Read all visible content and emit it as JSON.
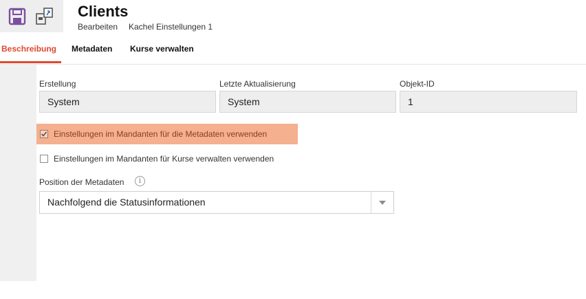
{
  "header": {
    "title": "Clients",
    "breadcrumb_1": "Bearbeiten",
    "breadcrumb_2": "Kachel Einstellungen 1",
    "tools": [
      {
        "icon": "save-icon",
        "color": "#7b4fa0"
      },
      {
        "icon": "sync-icon",
        "color": "#555555"
      }
    ]
  },
  "tabs": [
    {
      "label": "Beschreibung",
      "active": true
    },
    {
      "label": "Metadaten",
      "active": false
    },
    {
      "label": "Kurse verwalten",
      "active": false
    }
  ],
  "fields": {
    "created": {
      "label": "Erstellung",
      "value": "System"
    },
    "updated": {
      "label": "Letzte Aktualisierung",
      "value": "System"
    },
    "object_id": {
      "label": "Objekt-ID",
      "value": "1"
    }
  },
  "checkboxes": [
    {
      "label": "Einstellungen im Mandanten für die Metadaten verwenden",
      "checked": true
    },
    {
      "label": "Einstellungen im Mandanten für Kurse verwalten verwenden",
      "checked": false
    }
  ],
  "position": {
    "label": "Position der Metadaten",
    "info_icon": "info-icon",
    "selected": "Nachfolgend die Statusinformationen"
  },
  "colors": {
    "accent": "#e0482f",
    "highlight": "#f4b08f",
    "field_bg": "#eeeeee"
  }
}
